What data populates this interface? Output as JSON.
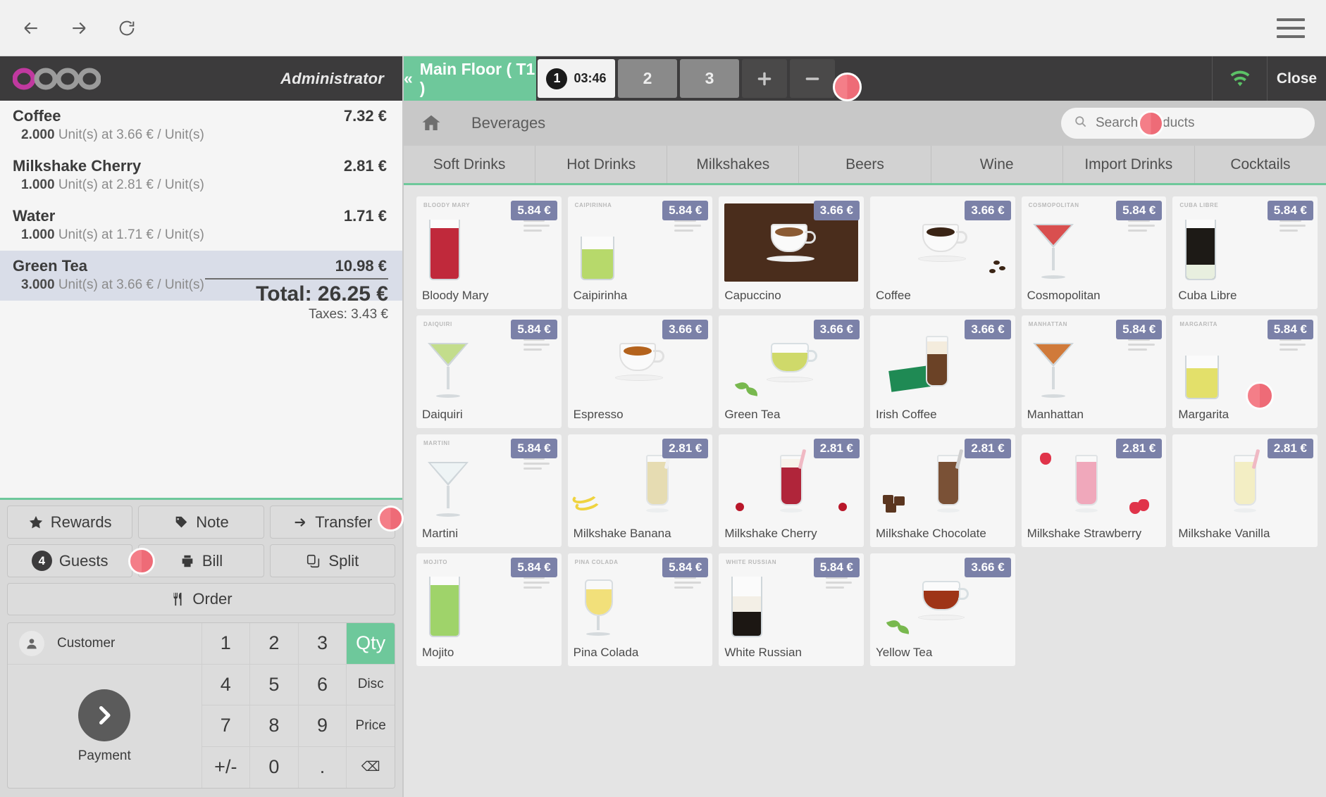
{
  "browser": {
    "back_icon": "arrow-left-icon",
    "forward_icon": "arrow-right-icon",
    "reload_icon": "reload-icon",
    "menu_icon": "hamburger-menu-icon"
  },
  "pos_header": {
    "brand": "odoo",
    "user": "Administrator",
    "wifi_icon": "wifi-icon",
    "close_label": "Close"
  },
  "table_bar": {
    "floor_label": "Main Floor ( T1 )",
    "floor_back_icon": "chevron-double-left-icon",
    "tabs": [
      {
        "number": "1",
        "timer": "03:46",
        "active": true
      },
      {
        "number": "2",
        "timer": "",
        "active": false
      },
      {
        "number": "3",
        "timer": "",
        "active": false
      }
    ],
    "add_label": "+",
    "remove_label": "−"
  },
  "breadcrumb": {
    "home_icon": "home-icon",
    "label": "Beverages"
  },
  "search": {
    "icon": "search-icon",
    "placeholder": "Search Products",
    "value": ""
  },
  "categories": [
    "Soft Drinks",
    "Hot Drinks",
    "Milkshakes",
    "Beers",
    "Wine",
    "Import Drinks",
    "Cocktails"
  ],
  "order": {
    "lines": [
      {
        "name": "Coffee",
        "qty": "2.000",
        "detail": "Unit(s) at 3.66 € / Unit(s)",
        "price": "7.32 €",
        "selected": false
      },
      {
        "name": "Milkshake Cherry",
        "qty": "1.000",
        "detail": "Unit(s) at 2.81 € / Unit(s)",
        "price": "2.81 €",
        "selected": false
      },
      {
        "name": "Water",
        "qty": "1.000",
        "detail": "Unit(s) at 1.71 € / Unit(s)",
        "price": "1.71 €",
        "selected": false
      },
      {
        "name": "Green Tea",
        "qty": "3.000",
        "detail": "Unit(s) at 3.66 € / Unit(s)",
        "price": "10.98 €",
        "selected": true
      }
    ],
    "total_label": "Total: 26.25 €",
    "taxes_label": "Taxes: 3.43 €"
  },
  "actions": {
    "rewards": "Rewards",
    "note": "Note",
    "transfer": "Transfer",
    "guests": "Guests",
    "guests_count": "4",
    "bill": "Bill",
    "split": "Split",
    "order": "Order",
    "rewards_icon": "star-icon",
    "note_icon": "tag-icon",
    "transfer_icon": "arrow-right-icon",
    "bill_icon": "printer-icon",
    "split_icon": "copy-icon",
    "order_icon": "cutlery-icon"
  },
  "keypad": {
    "customer_label": "Customer",
    "customer_icon": "user-icon",
    "payment_label": "Payment",
    "payment_icon": "chevron-right-icon",
    "keys": [
      {
        "label": "1",
        "mode": "digit"
      },
      {
        "label": "2",
        "mode": "digit"
      },
      {
        "label": "3",
        "mode": "digit"
      },
      {
        "label": "Qty",
        "mode": "active"
      },
      {
        "label": "4",
        "mode": "digit"
      },
      {
        "label": "5",
        "mode": "digit"
      },
      {
        "label": "6",
        "mode": "digit"
      },
      {
        "label": "Disc",
        "mode": "small"
      },
      {
        "label": "7",
        "mode": "digit"
      },
      {
        "label": "8",
        "mode": "digit"
      },
      {
        "label": "9",
        "mode": "digit"
      },
      {
        "label": "Price",
        "mode": "small"
      },
      {
        "label": "+/-",
        "mode": "digit"
      },
      {
        "label": "0",
        "mode": "digit"
      },
      {
        "label": ".",
        "mode": "digit"
      },
      {
        "label": "⌫",
        "mode": "small"
      }
    ]
  },
  "products": [
    {
      "name": "Bloody Mary",
      "price": "5.84 €",
      "art": "highball",
      "color": "#c0293b",
      "label": "BLOODY MARY"
    },
    {
      "name": "Caipirinha",
      "price": "5.84 €",
      "art": "tumbler",
      "color": "#b7d96b",
      "label": "CAIPIRINHA"
    },
    {
      "name": "Capuccino",
      "price": "3.66 €",
      "art": "beans-mug",
      "color": "#8a5a33",
      "label": ""
    },
    {
      "name": "Coffee",
      "price": "3.66 €",
      "art": "coffee-mug",
      "color": "#3a2415",
      "label": ""
    },
    {
      "name": "Cosmopolitan",
      "price": "5.84 €",
      "art": "martini",
      "color": "#d94f4f",
      "label": "COSMOPOLITAN"
    },
    {
      "name": "Cuba Libre",
      "price": "5.84 €",
      "art": "cola",
      "color": "#1d1a16",
      "label": "CUBA LIBRE"
    },
    {
      "name": "Daiquiri",
      "price": "5.84 €",
      "art": "martini",
      "color": "#c3dd8c",
      "label": "DAIQUIRI"
    },
    {
      "name": "Espresso",
      "price": "3.66 €",
      "art": "espresso-mug",
      "color": "#b4631d",
      "label": ""
    },
    {
      "name": "Green Tea",
      "price": "3.66 €",
      "art": "green-tea",
      "color": "#cfd96a",
      "label": ""
    },
    {
      "name": "Irish Coffee",
      "price": "3.66 €",
      "art": "irish",
      "color": "#6b4226",
      "label": ""
    },
    {
      "name": "Manhattan",
      "price": "5.84 €",
      "art": "martini",
      "color": "#d07a3a",
      "label": "MANHATTAN"
    },
    {
      "name": "Margarita",
      "price": "5.84 €",
      "art": "tumbler",
      "color": "#e3e06a",
      "label": "MARGARITA"
    },
    {
      "name": "Martini",
      "price": "5.84 €",
      "art": "martini",
      "color": "#eef4f5",
      "label": "MARTINI"
    },
    {
      "name": "Milkshake Banana",
      "price": "2.81 €",
      "art": "banana-shake",
      "color": "#e6dcb2",
      "label": ""
    },
    {
      "name": "Milkshake Cherry",
      "price": "2.81 €",
      "art": "cherry-shake",
      "color": "#b0253a",
      "label": ""
    },
    {
      "name": "Milkshake Chocolate",
      "price": "2.81 €",
      "art": "choc-shake",
      "color": "#7a5136",
      "label": ""
    },
    {
      "name": "Milkshake Strawberry",
      "price": "2.81 €",
      "art": "straw-shake",
      "color": "#f0a8bb",
      "label": ""
    },
    {
      "name": "Milkshake Vanilla",
      "price": "2.81 €",
      "art": "vanilla-shake",
      "color": "#f3eec4",
      "label": ""
    },
    {
      "name": "Mojito",
      "price": "5.84 €",
      "art": "highball",
      "color": "#9fd36a",
      "label": "MOJITO"
    },
    {
      "name": "Pina Colada",
      "price": "5.84 €",
      "art": "pina",
      "color": "#f2e07a",
      "label": "PINA COLADA"
    },
    {
      "name": "White Russian",
      "price": "5.84 €",
      "art": "white-russian",
      "color": "#1c1713",
      "label": "WHITE RUSSIAN"
    },
    {
      "name": "Yellow Tea",
      "price": "3.66 €",
      "art": "yellow-tea",
      "color": "#9e3417",
      "label": ""
    }
  ]
}
